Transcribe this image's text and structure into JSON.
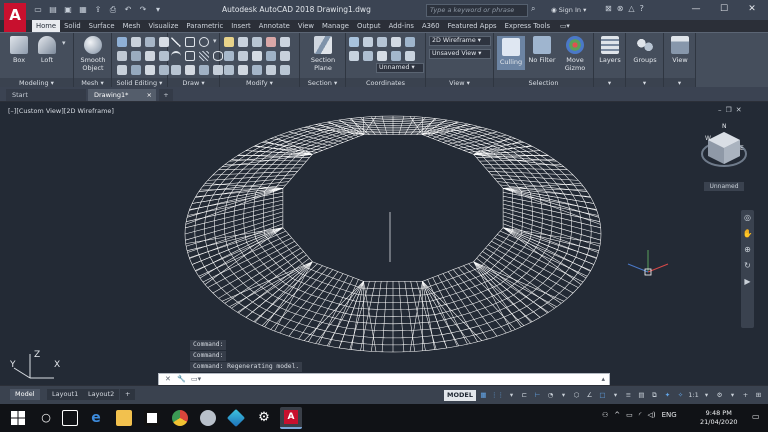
{
  "app": {
    "logo": "A",
    "title": "Autodesk AutoCAD 2018    Drawing1.dwg",
    "search_placeholder": "Type a keyword or phrase",
    "sign_in": "Sign In"
  },
  "ribbon_tabs": [
    "Home",
    "Solid",
    "Surface",
    "Mesh",
    "Visualize",
    "Parametric",
    "Insert",
    "Annotate",
    "View",
    "Manage",
    "Output",
    "Add-ins",
    "A360",
    "Featured Apps",
    "Express Tools"
  ],
  "ribbon": {
    "groups": {
      "modeling": "Modeling",
      "mesh": "Mesh",
      "solid_editing": "Solid Editing",
      "draw": "Draw",
      "modify": "Modify",
      "section": "Section",
      "coordinates": "Coordinates",
      "view": "View",
      "selection": "Selection"
    },
    "buttons": {
      "box": "Box",
      "loft": "Loft",
      "smooth_object": "Smooth Object",
      "section_plane": "Section Plane",
      "culling": "Culling",
      "no_filter": "No Filter",
      "move_gizmo": "Move Gizmo",
      "layers": "Layers",
      "groups": "Groups",
      "view": "View"
    },
    "visual_style": "2D Wireframe",
    "named_view": "Unsaved View",
    "ucs": "Unnamed"
  },
  "file_tabs": [
    "Start",
    "Drawing1*"
  ],
  "viewport": {
    "label": "[–][Custom View][2D Wireframe]",
    "viewcube_label": "Unnamed",
    "ucs_x": "X",
    "ucs_y": "Y",
    "ucs_z": "Z"
  },
  "command": {
    "history": [
      "Command:",
      "Command:",
      "Command:  Regenerating model."
    ],
    "input_value": ""
  },
  "layout_tabs": [
    "Model",
    "Layout1",
    "Layout2"
  ],
  "status_bar": {
    "model": "MODEL",
    "scale": "1:1"
  },
  "taskbar": {
    "language": "ENG",
    "time": "9:48 PM",
    "date": "21/04/2020"
  },
  "colors": {
    "viewport_bg": "#232a35",
    "wireframe": "#ffffff",
    "logo_red": "#c8102e",
    "active_blue": "#62a5e8"
  }
}
